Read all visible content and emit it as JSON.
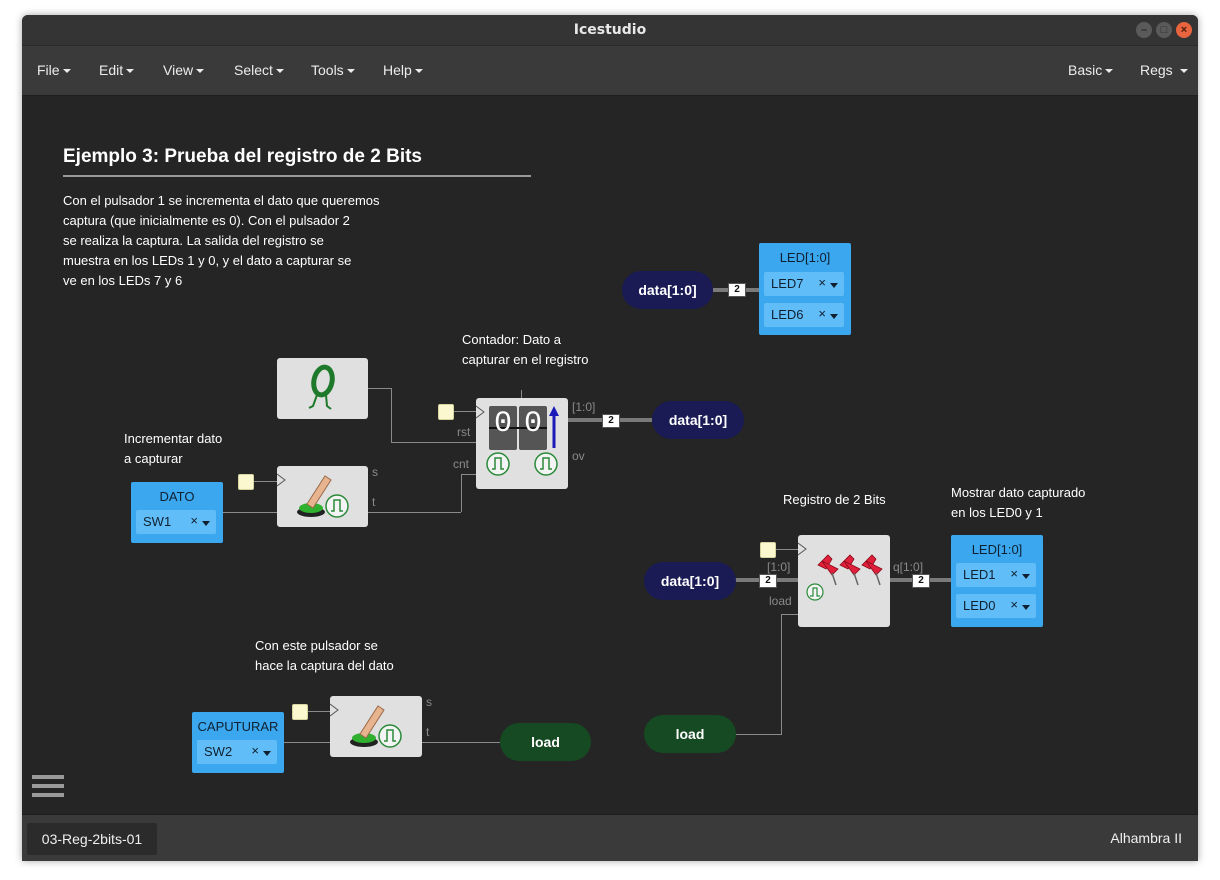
{
  "window": {
    "title": "Icestudio",
    "buttons": {
      "minimize": "–",
      "maximize": "□",
      "close": "×"
    }
  },
  "menu": {
    "file": "File",
    "edit": "Edit",
    "view": "View",
    "select": "Select",
    "tools": "Tools",
    "help": "Help",
    "basic": "Basic",
    "regs": "Regs"
  },
  "canvas": {
    "heading": "Ejemplo 3: Prueba del registro de 2 Bits",
    "description": [
      "Con el pulsador 1 se incrementa el dato que queremos",
      "captura (que inicialmente es 0). Con el pulsador 2",
      "se realiza la captura. La salida del registro se",
      "muestra en los LEDs 1 y 0, y el dato a capturar se",
      "ve en los LEDs 7 y 6"
    ],
    "comment_counter": [
      "Contador: Dato a",
      "capturar en el registro"
    ],
    "comment_increment": [
      "Incrementar dato",
      "a capturar"
    ],
    "comment_register": "Registro de 2 Bits",
    "comment_show": [
      "Mostrar dato capturado",
      "en los LED0 y 1"
    ],
    "comment_capture": [
      "Con este pulsador se",
      "hace la captura del dato"
    ],
    "input_dato": {
      "title": "DATO",
      "pin": "SW1",
      "clear": "×"
    },
    "input_capturar": {
      "title": "CAPUTURAR",
      "pin": "SW2",
      "clear": "×"
    },
    "led_top": {
      "title": "LED[1:0]",
      "pins": [
        "LED7",
        "LED6"
      ],
      "clear": "×"
    },
    "led_bottom": {
      "title": "LED[1:0]",
      "pins": [
        "LED1",
        "LED0"
      ],
      "clear": "×"
    },
    "label_data_top": "data[1:0]",
    "label_data_counter": "data[1:0]",
    "label_data_register": "data[1:0]",
    "label_load_out": "load",
    "label_load_in": "load",
    "counter": {
      "pin_rst": "rst",
      "pin_cnt": "cnt",
      "pin_ov": "ov",
      "out_range": "[1:0]",
      "digits": [
        "0",
        "0"
      ]
    },
    "button1": {
      "pin_s": "s",
      "pin_t": "t"
    },
    "button2": {
      "pin_s": "s",
      "pin_t": "t"
    },
    "register": {
      "in_range": "[1:0]",
      "pin_load": "load",
      "out_range": "q[1:0]"
    },
    "bus_width": "2",
    "colors": {
      "accent": "#3aa7ef",
      "navy": "#1a1a55",
      "green": "#164a22",
      "canvas": "#252525"
    }
  },
  "status": {
    "file_tab": "03-Reg-2bits-01",
    "board": "Alhambra II"
  }
}
